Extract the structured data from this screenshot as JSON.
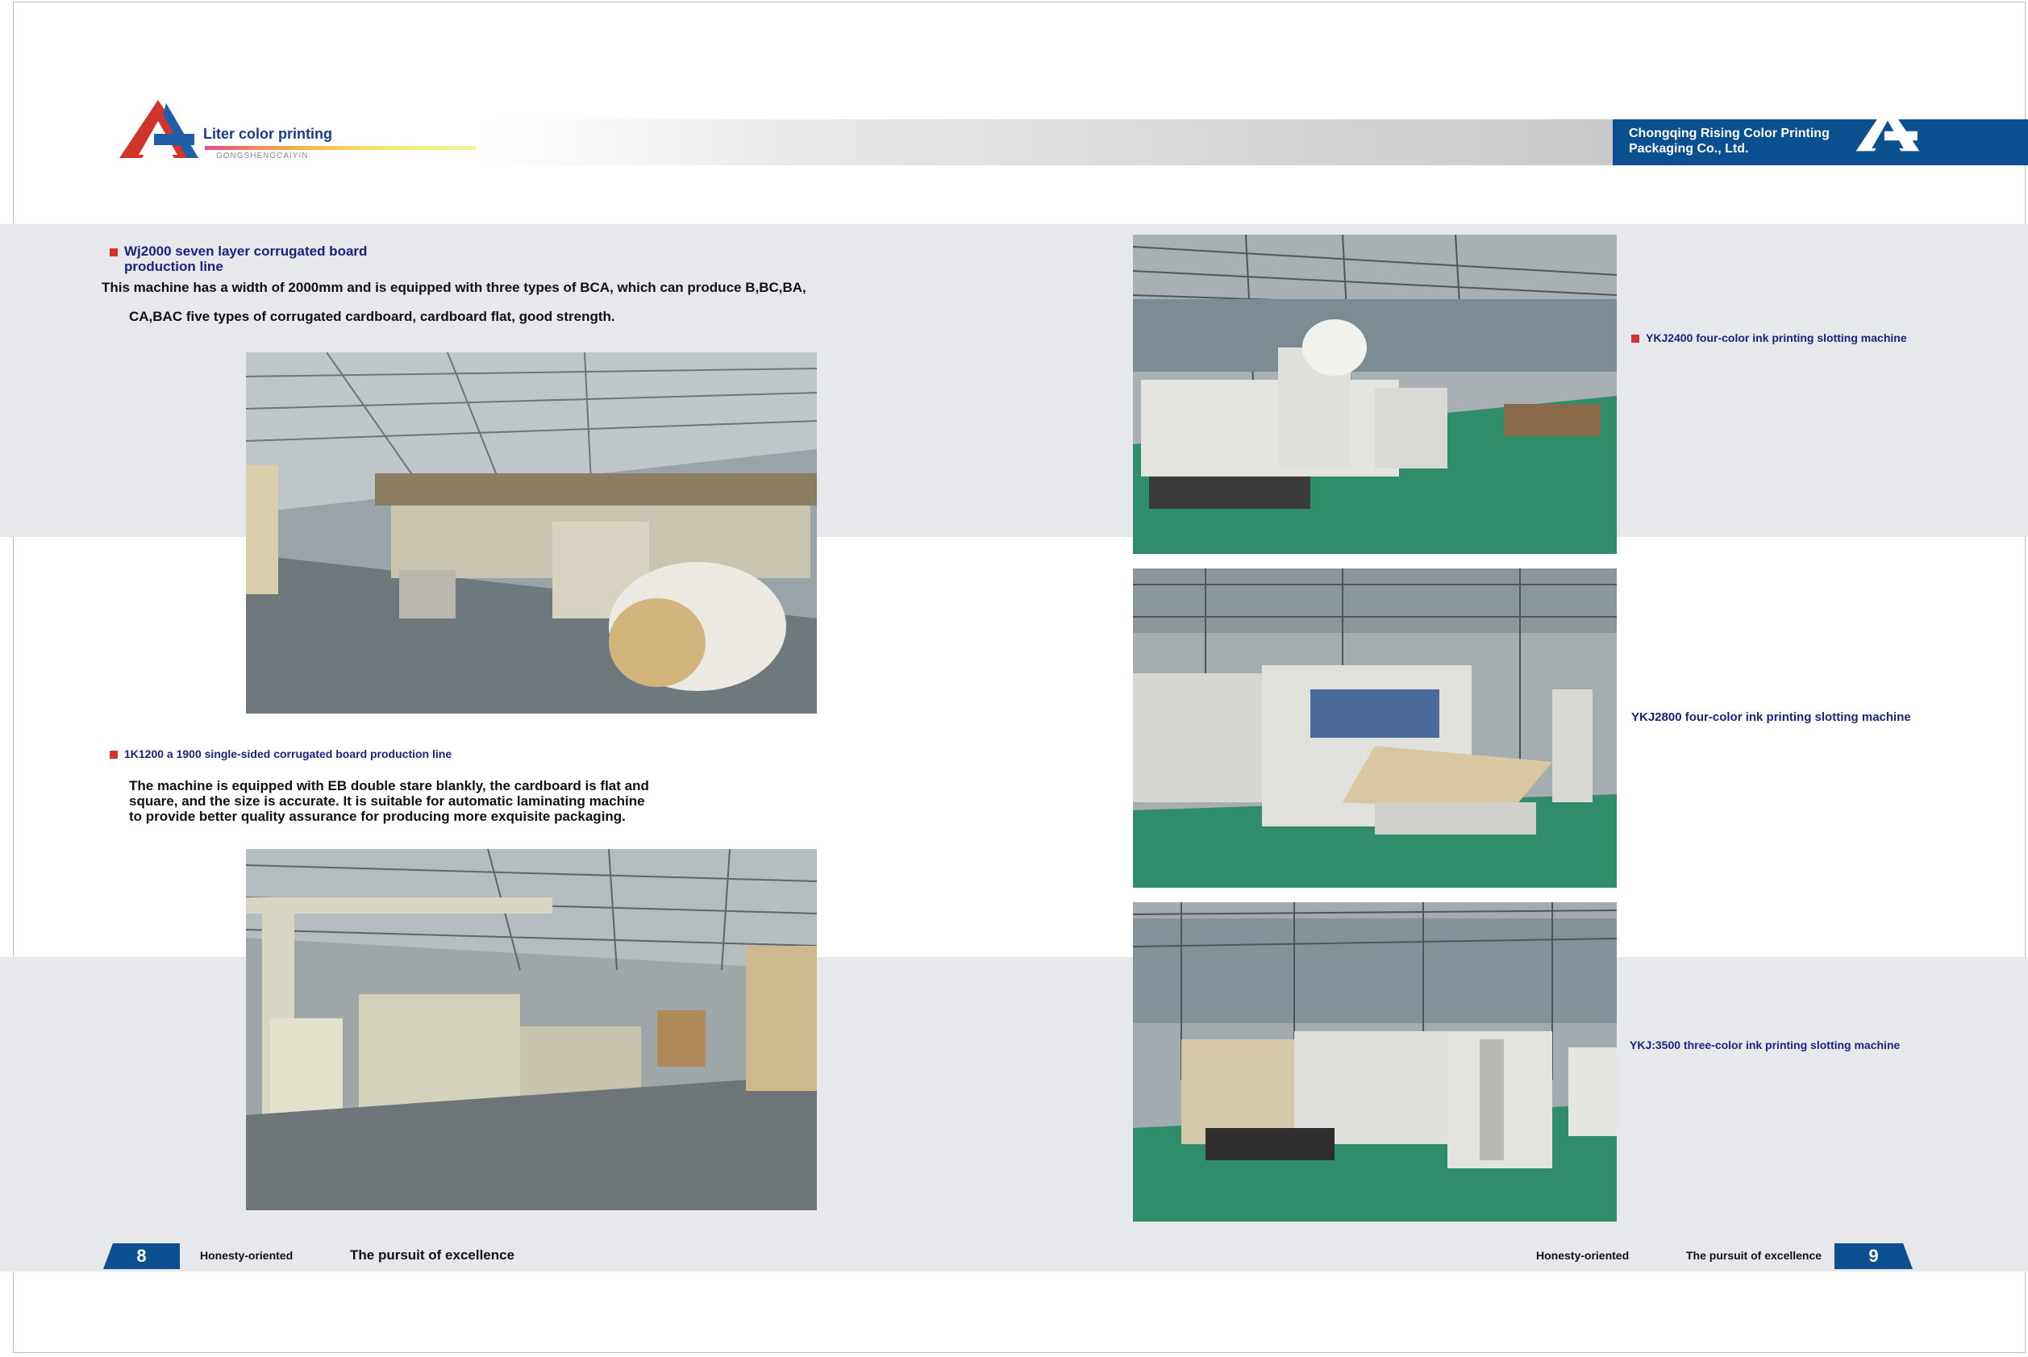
{
  "header": {
    "brand_name": "Liter color printing",
    "brand_sub": "GONGSHENGCAIYIN",
    "company_line1": "Chongqing Rising Color Printing",
    "company_line2": "Packaging Co., Ltd.",
    "accent_color": "#0a4f8f",
    "logo_red": "#d0342c"
  },
  "left": {
    "section1": {
      "title_line1": "Wj2000 seven layer corrugated board",
      "title_line2": "production line",
      "text_line1": "This machine has a width of 2000mm and is equipped with three types of BCA, which can produce B,BC,BA,",
      "text_line2": "CA,BAC five types of corrugated cardboard, cardboard flat, good strength."
    },
    "section2": {
      "title": "1K1200 a 1900 single-sided corrugated board production line",
      "text_line1": "The machine is equipped with EB double stare blankly, the cardboard is flat and",
      "text_line2": "square, and the size is accurate. It is suitable for automatic laminating machine",
      "text_line3": "to provide better quality assurance for producing more exquisite packaging."
    }
  },
  "right": {
    "caption1": "YKJ2400 four-color ink printing slotting machine",
    "caption2": "YKJ2800 four-color ink printing slotting machine",
    "caption3": "YKJ:3500 three-color ink printing slotting machine"
  },
  "footer": {
    "left_page": "8",
    "left_motto1": "Honesty-oriented",
    "left_motto2": "The pursuit of excellence",
    "right_motto1": "Honesty-oriented",
    "right_motto2": "The pursuit of excellence",
    "right_page": "9"
  }
}
